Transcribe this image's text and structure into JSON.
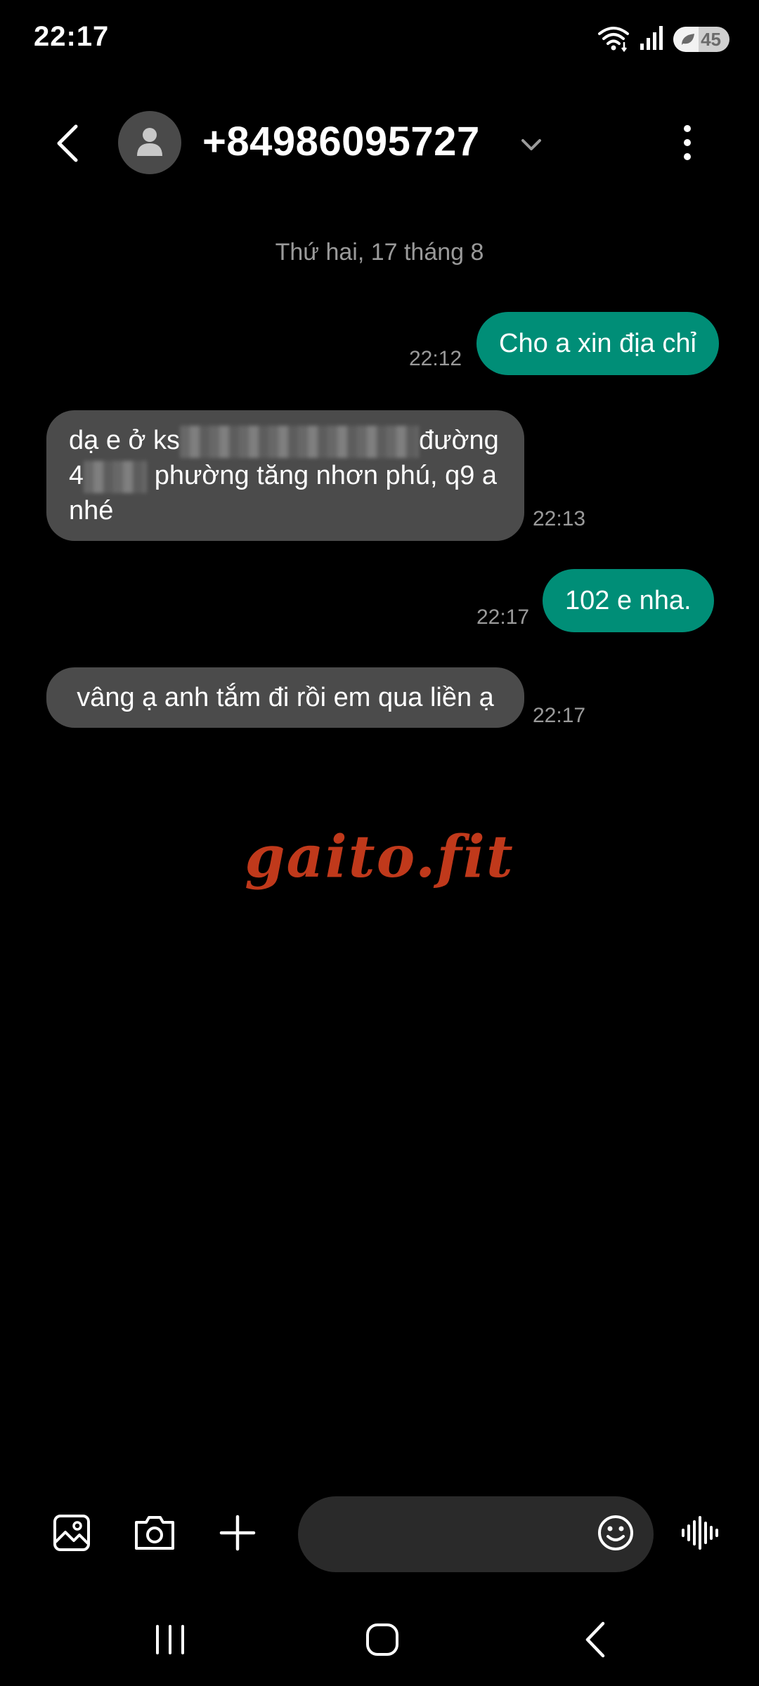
{
  "status_bar": {
    "time": "22:17",
    "battery_level": "45",
    "battery_fraction": 0.45,
    "icons": [
      "wifi-icon",
      "signal-icon",
      "battery-icon"
    ]
  },
  "header": {
    "contact": "+84986095727",
    "icons": [
      "back-arrow-icon",
      "avatar-person-icon",
      "chevron-down-icon",
      "more-vertical-icon"
    ]
  },
  "conversation": {
    "date_label": "Thứ hai, 17 tháng 8",
    "messages": [
      {
        "direction": "sent",
        "text": "Cho a xin địa chỉ",
        "time": "22:12"
      },
      {
        "direction": "received",
        "line1_start": "dạ e ở ks",
        "line1_end": "đường",
        "line2_start": "4",
        "line2_rest": "phường tăng nhơn phú, q9 a",
        "line3": "nhé",
        "time": "22:13"
      },
      {
        "direction": "sent",
        "text": "102 e nha.",
        "time": "22:17"
      },
      {
        "direction": "received",
        "text": "vâng ạ anh tắm đi rồi em qua liền ạ",
        "time": "22:17"
      }
    ]
  },
  "watermark": "gaito.fit",
  "composer": {
    "placeholder": "",
    "value": "",
    "icons": [
      "gallery-icon",
      "camera-icon",
      "plus-icon",
      "emoji-icon",
      "voice-icon"
    ]
  },
  "nav_bar": {
    "icons": [
      "recent-apps-icon",
      "home-icon",
      "back-icon"
    ]
  },
  "colors": {
    "background": "#000000",
    "sent_bubble": "#008e77",
    "received_bubble": "#4b4b4b",
    "secondary_text": "#9a9a9a",
    "watermark": "#c0391b"
  }
}
